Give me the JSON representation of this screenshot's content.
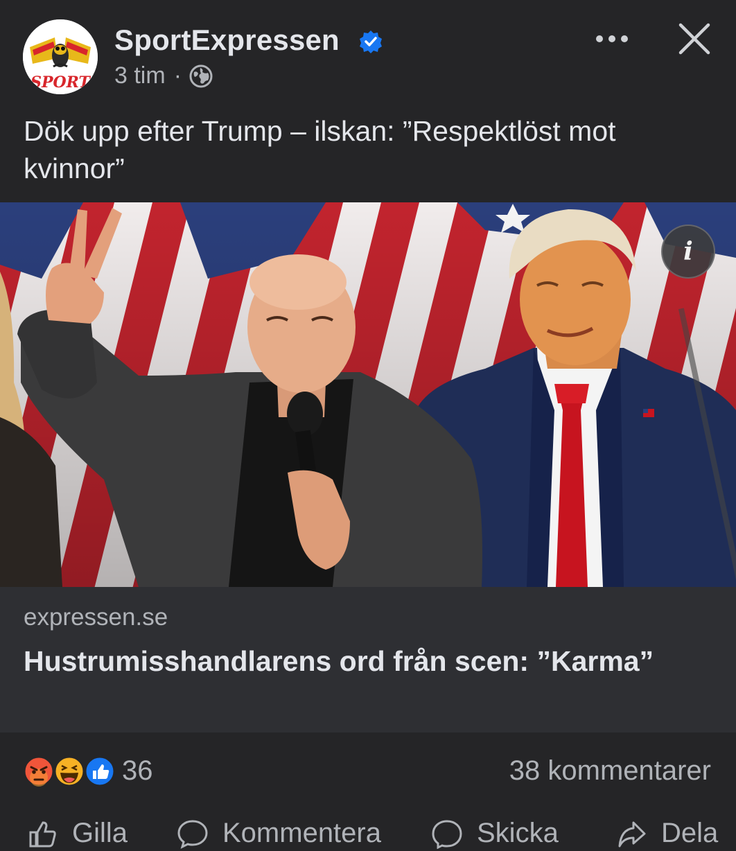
{
  "post": {
    "page_name": "SportExpressen",
    "time": "3 tim",
    "separator": "·",
    "text": "Dök upp efter Trump – ilskan: ”Respektlöst mot kvinnor”"
  },
  "link": {
    "domain": "expressen.se",
    "title": "Hustrumisshandlarens ord från scen: ”Karma”"
  },
  "reactions": {
    "types": [
      "angry",
      "haha",
      "like"
    ],
    "count": "36",
    "comments": "38 kommentarer"
  },
  "actions": {
    "like": "Gilla",
    "comment": "Kommentera",
    "send": "Skicka",
    "share": "Dela"
  },
  "icons": {
    "more": "more-dots-icon",
    "close": "close-icon",
    "verified": "verified-badge-icon",
    "audience": "globe-icon",
    "info": "info-icon"
  },
  "colors": {
    "background": "#252527",
    "card": "#2e2f33",
    "text": "#e4e6eb",
    "muted": "#b0b3b8",
    "verified": "#1877f2",
    "like": "#1877f2",
    "angry": "#f0553a",
    "haha": "#f7b125"
  }
}
